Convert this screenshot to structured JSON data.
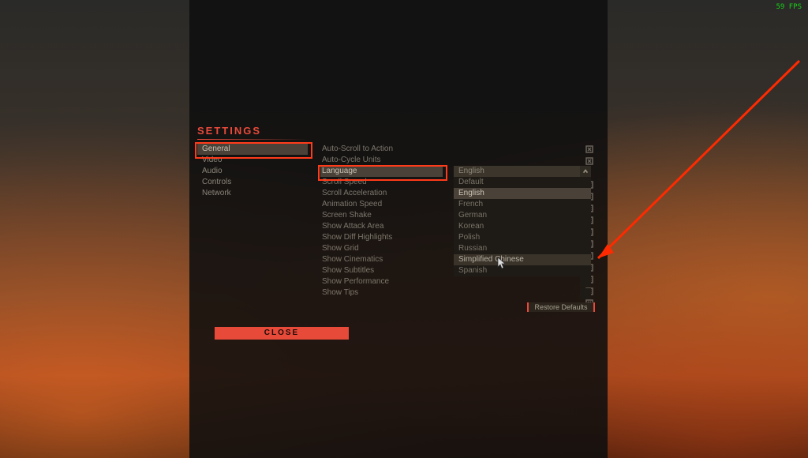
{
  "fps": "59 FPS",
  "title": "SETTINGS",
  "tabs": [
    "General",
    "Video",
    "Audio",
    "Controls",
    "Network"
  ],
  "active_tab": 0,
  "options": [
    "Auto-Scroll to Action",
    "Auto-Cycle Units",
    "Language",
    "Scroll Speed",
    "Scroll Acceleration",
    "Animation Speed",
    "Screen Shake",
    "Show Attack Area",
    "Show Diff Highlights",
    "Show Grid",
    "Show Cinematics",
    "Show Subtitles",
    "Show Performance",
    "Show Tips"
  ],
  "highlight_option": 2,
  "dropdown": {
    "selected": "English",
    "items": [
      "Default",
      "English",
      "French",
      "German",
      "Korean",
      "Polish",
      "Russian",
      "Simplified Chinese",
      "Spanish"
    ],
    "selected_index": 1,
    "hover_index": 7
  },
  "restore_label": "Restore Defaults",
  "close_label": "CLOSE"
}
